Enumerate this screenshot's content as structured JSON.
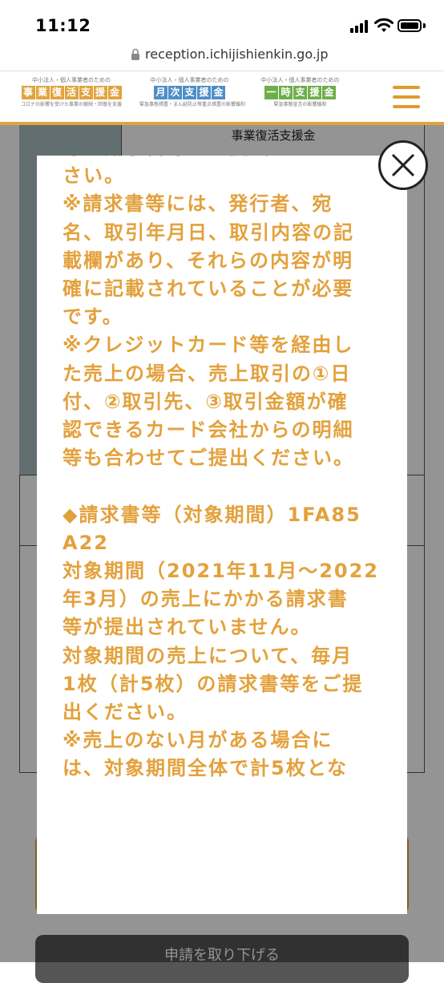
{
  "status_bar": {
    "time": "11:12"
  },
  "browser": {
    "url": "reception.ichijishienkin.go.jp"
  },
  "header": {
    "brands": [
      {
        "tag": "中小法人・個人事業者のための",
        "name_chars": [
          "事",
          "業",
          "復",
          "活",
          "支",
          "援",
          "金"
        ],
        "sub": "コロナの影響を受けた事業の継続・回復を支援",
        "color": "#e0a33d"
      },
      {
        "tag": "中小法人・個人事業者のための",
        "name_chars": [
          "月",
          "次",
          "支",
          "援",
          "金"
        ],
        "sub": "緊急事態措置・まん延防止等重点措置の影響緩和",
        "color": "#4d8fc7"
      },
      {
        "tag": "中小法人・個人事業者のための",
        "name_chars": [
          "一",
          "時",
          "支",
          "援",
          "金"
        ],
        "sub": "緊急事態宣言の影響緩和",
        "color": "#6eae4a"
      }
    ]
  },
  "background": {
    "table_heading": "事業復活支援金",
    "bottom_button_label": "申請を取り下げる"
  },
  "modal": {
    "lines": [
      "等の請求書等をご提出ください。",
      "さい。",
      "※請求書等には、発行者、宛",
      "名、取引年月日、取引内容の記",
      "載欄があり、それらの内容が明",
      "確に記載されていることが必要",
      "です。",
      "※クレジットカード等を経由し",
      "た売上の場合、売上取引の①日",
      "付、②取引先、③取引金額が確",
      "認できるカード会社からの明細",
      "等も合わせてご提出ください。",
      "",
      "◆請求書等（対象期間）1FA85",
      "A22",
      "対象期間（2021年11月〜2022",
      "年3月）の売上にかかる請求書",
      "等が提出されていません。",
      "対象期間の売上について、毎月",
      "1枚（計5枚）の請求書等をご提",
      "出ください。",
      "※売上のない月がある場合に",
      "は、対象期間全体で計5枚とな"
    ]
  }
}
